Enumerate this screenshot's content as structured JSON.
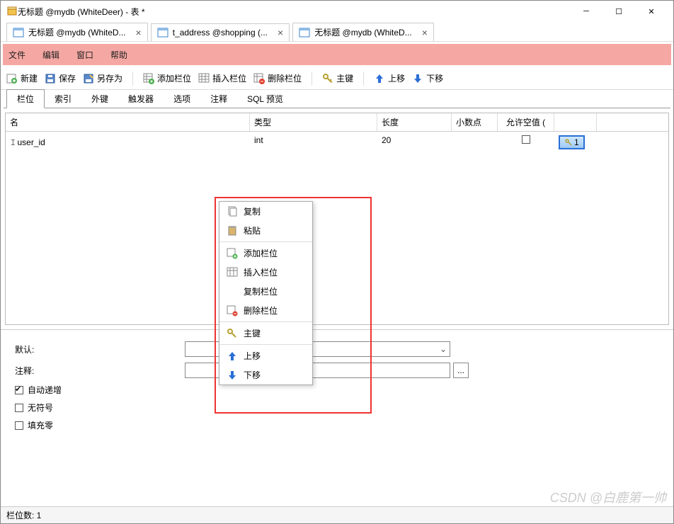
{
  "window": {
    "title": "无标题 @mydb (WhiteDeer) - 表 *"
  },
  "doc_tabs": [
    {
      "label": "无标题 @mydb (WhiteD...",
      "active": false
    },
    {
      "label": "t_address @shopping (...",
      "active": false
    },
    {
      "label": "无标题 @mydb (WhiteD...",
      "active": true
    }
  ],
  "menu": {
    "file": "文件",
    "edit": "编辑",
    "window": "窗口",
    "help": "帮助"
  },
  "toolbar": {
    "new": "新建",
    "save": "保存",
    "saveAs": "另存为",
    "addCol": "添加栏位",
    "insertCol": "插入栏位",
    "delCol": "删除栏位",
    "pk": "主键",
    "up": "上移",
    "down": "下移"
  },
  "subtabs": [
    "栏位",
    "索引",
    "外键",
    "触发器",
    "选项",
    "注释",
    "SQL 预览"
  ],
  "grid": {
    "headers": {
      "name": "名",
      "type": "类型",
      "len": "长度",
      "dec": "小数点",
      "null": "允许空值 ("
    },
    "rows": [
      {
        "name": "user_id",
        "type": "int",
        "len": "20",
        "dec": "",
        "null": false,
        "pk": "1"
      }
    ]
  },
  "props": {
    "default": "默认:",
    "comment": "注释:",
    "autoInc": "自动递增",
    "unsigned": "无符号",
    "zerofill": "填充零",
    "autoIncChecked": true
  },
  "context": {
    "copy": "复制",
    "paste": "粘贴",
    "addCol": "添加栏位",
    "insertCol": "插入栏位",
    "copyCol": "复制栏位",
    "delCol": "删除栏位",
    "pk": "主键",
    "up": "上移",
    "down": "下移"
  },
  "status": {
    "colCount": "栏位数: 1"
  },
  "watermark": "CSDN @白鹿第一帅"
}
